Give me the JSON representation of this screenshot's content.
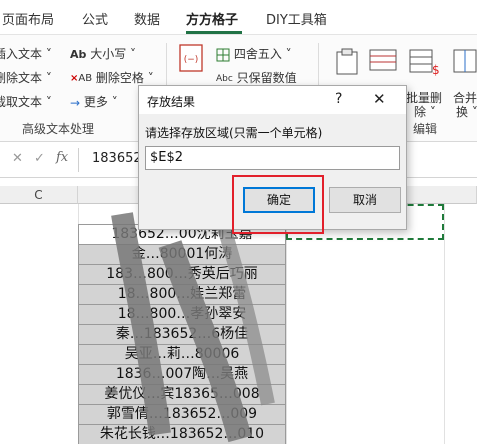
{
  "ribbon_tabs": [
    {
      "label": "页面布局"
    },
    {
      "label": "公式"
    },
    {
      "label": "数据"
    },
    {
      "label": "方方格子"
    },
    {
      "label": "DIY工具箱"
    }
  ],
  "ribbon": {
    "left_items": [
      "插入文本 ˅",
      "删除文本 ˅",
      "截取文本 ˅"
    ],
    "ab_case": "大小写 ˅",
    "delete_spaces": "删除空格 ˅",
    "more": "更多 ˅",
    "round": "四舍五入 ˅",
    "keep_value": "只保留数值",
    "batch_delete": "批量删",
    "batch_delete_2": "除 ˅",
    "merge": "合并",
    "merge_2": "换 ˅",
    "group_text": "高级文本处理",
    "group_edit": "编辑"
  },
  "formula_bar": {
    "fx": "fx",
    "content": "183652"
  },
  "column_header": "C",
  "cells": [
    "183652…00沈莉玉嘉",
    "金…80001何涛",
    "183…800…秀英后巧丽",
    "18…800…娃兰郑蕾",
    "18…800…孝孙翠安",
    "秦…183652…6杨佳",
    "吴亚…莉…80006",
    "1836…007陶…吴燕",
    "姜优仪…宾18365…008",
    "郭雪倩…183652…009",
    "朱花长钱…183652…010"
  ],
  "dialog": {
    "title": "存放结果",
    "help": "?",
    "close": "✕",
    "prompt": "请选择存放区域(只需一个单元格)",
    "input_value": "$E$2",
    "ok_label": "确定",
    "cancel_label": "取消"
  }
}
